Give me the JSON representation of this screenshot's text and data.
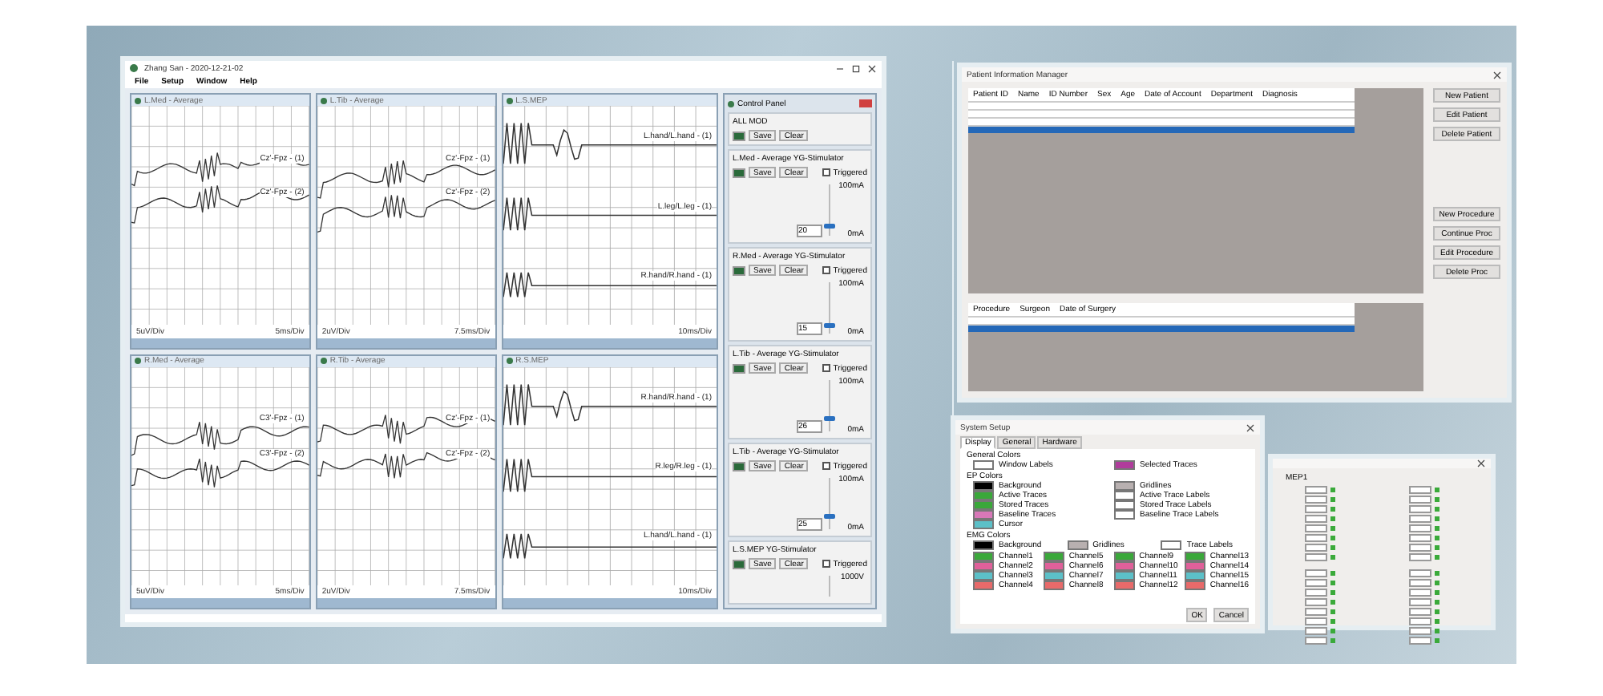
{
  "main_window": {
    "title": "Zhang San - 2020-12-21-02",
    "menu": [
      "File",
      "Setup",
      "Window",
      "Help"
    ],
    "panes": [
      {
        "title": "L.Med - Average",
        "kind": "ep",
        "left_scale": "5uV/Div",
        "right_scale": "5ms/Div",
        "traces": [
          "Cz'-Fpz - (1)",
          "Cz'-Fpz - (2)"
        ]
      },
      {
        "title": "L.Tib - Average",
        "kind": "ep",
        "left_scale": "2uV/Div",
        "right_scale": "7.5ms/Div",
        "traces": [
          "Cz'-Fpz - (1)",
          "Cz'-Fpz - (2)"
        ]
      },
      {
        "title": "L.S.MEP",
        "kind": "mep",
        "right_scale": "10ms/Div",
        "traces": [
          "L.hand/L.hand - (1)",
          "L.leg/L.leg - (1)",
          "R.hand/R.hand - (1)"
        ]
      },
      {
        "title": "R.Med - Average",
        "kind": "ep",
        "left_scale": "5uV/Div",
        "right_scale": "5ms/Div",
        "traces": [
          "C3'-Fpz - (1)",
          "C3'-Fpz - (2)"
        ]
      },
      {
        "title": "R.Tib - Average",
        "kind": "ep",
        "left_scale": "2uV/Div",
        "right_scale": "7.5ms/Div",
        "traces": [
          "Cz'-Fpz - (1)",
          "Cz'-Fpz - (2)"
        ]
      },
      {
        "title": "R.S.MEP",
        "kind": "mep",
        "right_scale": "10ms/Div",
        "traces": [
          "R.hand/R.hand - (1)",
          "R.leg/R.leg - (1)",
          "L.hand/L.hand - (1)"
        ]
      }
    ],
    "control_panel": {
      "title": "Control Panel",
      "sections": [
        {
          "kind": "all",
          "title": "ALL MOD",
          "save": "Save",
          "clear": "Clear"
        },
        {
          "kind": "stim",
          "title": "L.Med - Average  YG-Stimulator",
          "save": "Save",
          "clear": "Clear",
          "triggered_label": "Triggered",
          "triggered": false,
          "max": "100mA",
          "min": "0mA",
          "value": "20",
          "level": 0.2
        },
        {
          "kind": "stim",
          "title": "R.Med - Average  YG-Stimulator",
          "save": "Save",
          "clear": "Clear",
          "triggered_label": "Triggered",
          "triggered": false,
          "max": "100mA",
          "min": "0mA",
          "value": "15",
          "level": 0.15
        },
        {
          "kind": "stim",
          "title": "L.Tib - Average  YG-Stimulator",
          "save": "Save",
          "clear": "Clear",
          "triggered_label": "Triggered",
          "triggered": false,
          "max": "100mA",
          "min": "0mA",
          "value": "26",
          "level": 0.26
        },
        {
          "kind": "stim",
          "title": "L.Tib - Average  YG-Stimulator",
          "save": "Save",
          "clear": "Clear",
          "triggered_label": "Triggered",
          "triggered": false,
          "max": "100mA",
          "min": "0mA",
          "value": "25",
          "level": 0.25
        },
        {
          "kind": "stim_cut",
          "title": "L.S.MEP  YG-Stimulator",
          "save": "Save",
          "clear": "Clear",
          "triggered_label": "Triggered",
          "triggered": false,
          "max": "1000V"
        }
      ]
    }
  },
  "patient_window": {
    "title": "Patient Information Manager",
    "patient_columns": [
      "Patient ID",
      "Name",
      "ID Number",
      "Sex",
      "Age",
      "Date of Account",
      "Department",
      "Diagnosis"
    ],
    "patient_rows": [
      {
        "selected": false
      },
      {
        "selected": false
      },
      {
        "selected": false
      },
      {
        "selected": true
      }
    ],
    "patient_buttons": [
      "New Patient",
      "Edit Patient",
      "Delete Patient"
    ],
    "procedure_columns": [
      "Procedure",
      "Surgeon",
      "Date of Surgery"
    ],
    "procedure_rows": [
      {
        "selected": false
      },
      {
        "selected": true
      }
    ],
    "procedure_buttons": [
      "New Procedure",
      "Continue Proc",
      "Edit Procedure",
      "Delete Proc"
    ]
  },
  "system_setup": {
    "title": "System Setup",
    "tabs": [
      {
        "label": "Display",
        "selected": true
      },
      {
        "label": "General",
        "selected": false
      },
      {
        "label": "Hardware",
        "selected": false
      }
    ],
    "groups": [
      {
        "title": "General Colors",
        "items": [
          {
            "label": "Window Labels",
            "color": "#ffffff"
          },
          {
            "label": "Selected Traces",
            "color": "#b03c9c"
          }
        ]
      },
      {
        "title": "EP Colors",
        "items": [
          {
            "label": "Background",
            "color": "#000000"
          },
          {
            "label": "Gridlines",
            "color": "#b8b0b0"
          },
          {
            "label": "Active Traces",
            "color": "#3aa83a"
          },
          {
            "label": "Active Trace Labels",
            "color": "#ffffff"
          },
          {
            "label": "Stored Traces",
            "color": "#3aa83a"
          },
          {
            "label": "Stored Trace Labels",
            "color": "#ffffff"
          },
          {
            "label": "Baseline Traces",
            "color": "#d878b8"
          },
          {
            "label": "Baseline Trace Labels",
            "color": "#ffffff"
          },
          {
            "label": "Cursor",
            "color": "#5cc0c8"
          }
        ]
      },
      {
        "title": "EMG Colors",
        "items": [
          {
            "label": "Background",
            "color": "#000000"
          },
          {
            "label": "Gridlines",
            "color": "#b8b0b0"
          },
          {
            "label": "Trace Labels",
            "color": "#ffffff"
          }
        ]
      },
      {
        "items": [
          {
            "label": "Channel1",
            "color": "#3aa83a"
          },
          {
            "label": "Channel5",
            "color": "#3aa83a"
          },
          {
            "label": "Channel9",
            "color": "#3aa83a"
          },
          {
            "label": "Channel13",
            "color": "#3aa83a"
          },
          {
            "label": "Channel2",
            "color": "#e0609a"
          },
          {
            "label": "Channel6",
            "color": "#e0609a"
          },
          {
            "label": "Channel10",
            "color": "#e0609a"
          },
          {
            "label": "Channel14",
            "color": "#e0609a"
          },
          {
            "label": "Channel3",
            "color": "#5cc0c8"
          },
          {
            "label": "Channel7",
            "color": "#5cc0c8"
          },
          {
            "label": "Channel11",
            "color": "#5cc0c8"
          },
          {
            "label": "Channel15",
            "color": "#5cc0c8"
          },
          {
            "label": "Channel4",
            "color": "#e86a6a"
          },
          {
            "label": "Channel8",
            "color": "#e86a6a"
          },
          {
            "label": "Channel12",
            "color": "#e86a6a"
          },
          {
            "label": "Channel16",
            "color": "#e86a6a"
          }
        ]
      }
    ],
    "buttons": [
      "OK",
      "Cancel"
    ]
  },
  "mep_window": {
    "heading": "MEP1",
    "blocks": [
      {
        "rows": [
          {
            "on": true
          },
          {
            "on": true
          },
          {
            "on": true
          },
          {
            "on": true
          },
          {
            "on": true
          },
          {
            "on": true
          },
          {
            "on": true
          },
          {
            "on": true
          }
        ]
      },
      {
        "rows": [
          {
            "on": true
          },
          {
            "on": true
          },
          {
            "on": true
          },
          {
            "on": true
          },
          {
            "on": true
          },
          {
            "on": true
          },
          {
            "on": true
          },
          {
            "on": true
          }
        ]
      },
      {
        "rows": [
          {
            "on": true
          },
          {
            "on": true
          },
          {
            "on": true
          },
          {
            "on": true
          },
          {
            "on": true
          },
          {
            "on": true
          },
          {
            "on": true
          },
          {
            "on": true
          }
        ]
      },
      {
        "rows": [
          {
            "on": true
          },
          {
            "on": true
          },
          {
            "on": true
          },
          {
            "on": true
          },
          {
            "on": true
          },
          {
            "on": true
          },
          {
            "on": true
          },
          {
            "on": true
          }
        ]
      }
    ]
  }
}
